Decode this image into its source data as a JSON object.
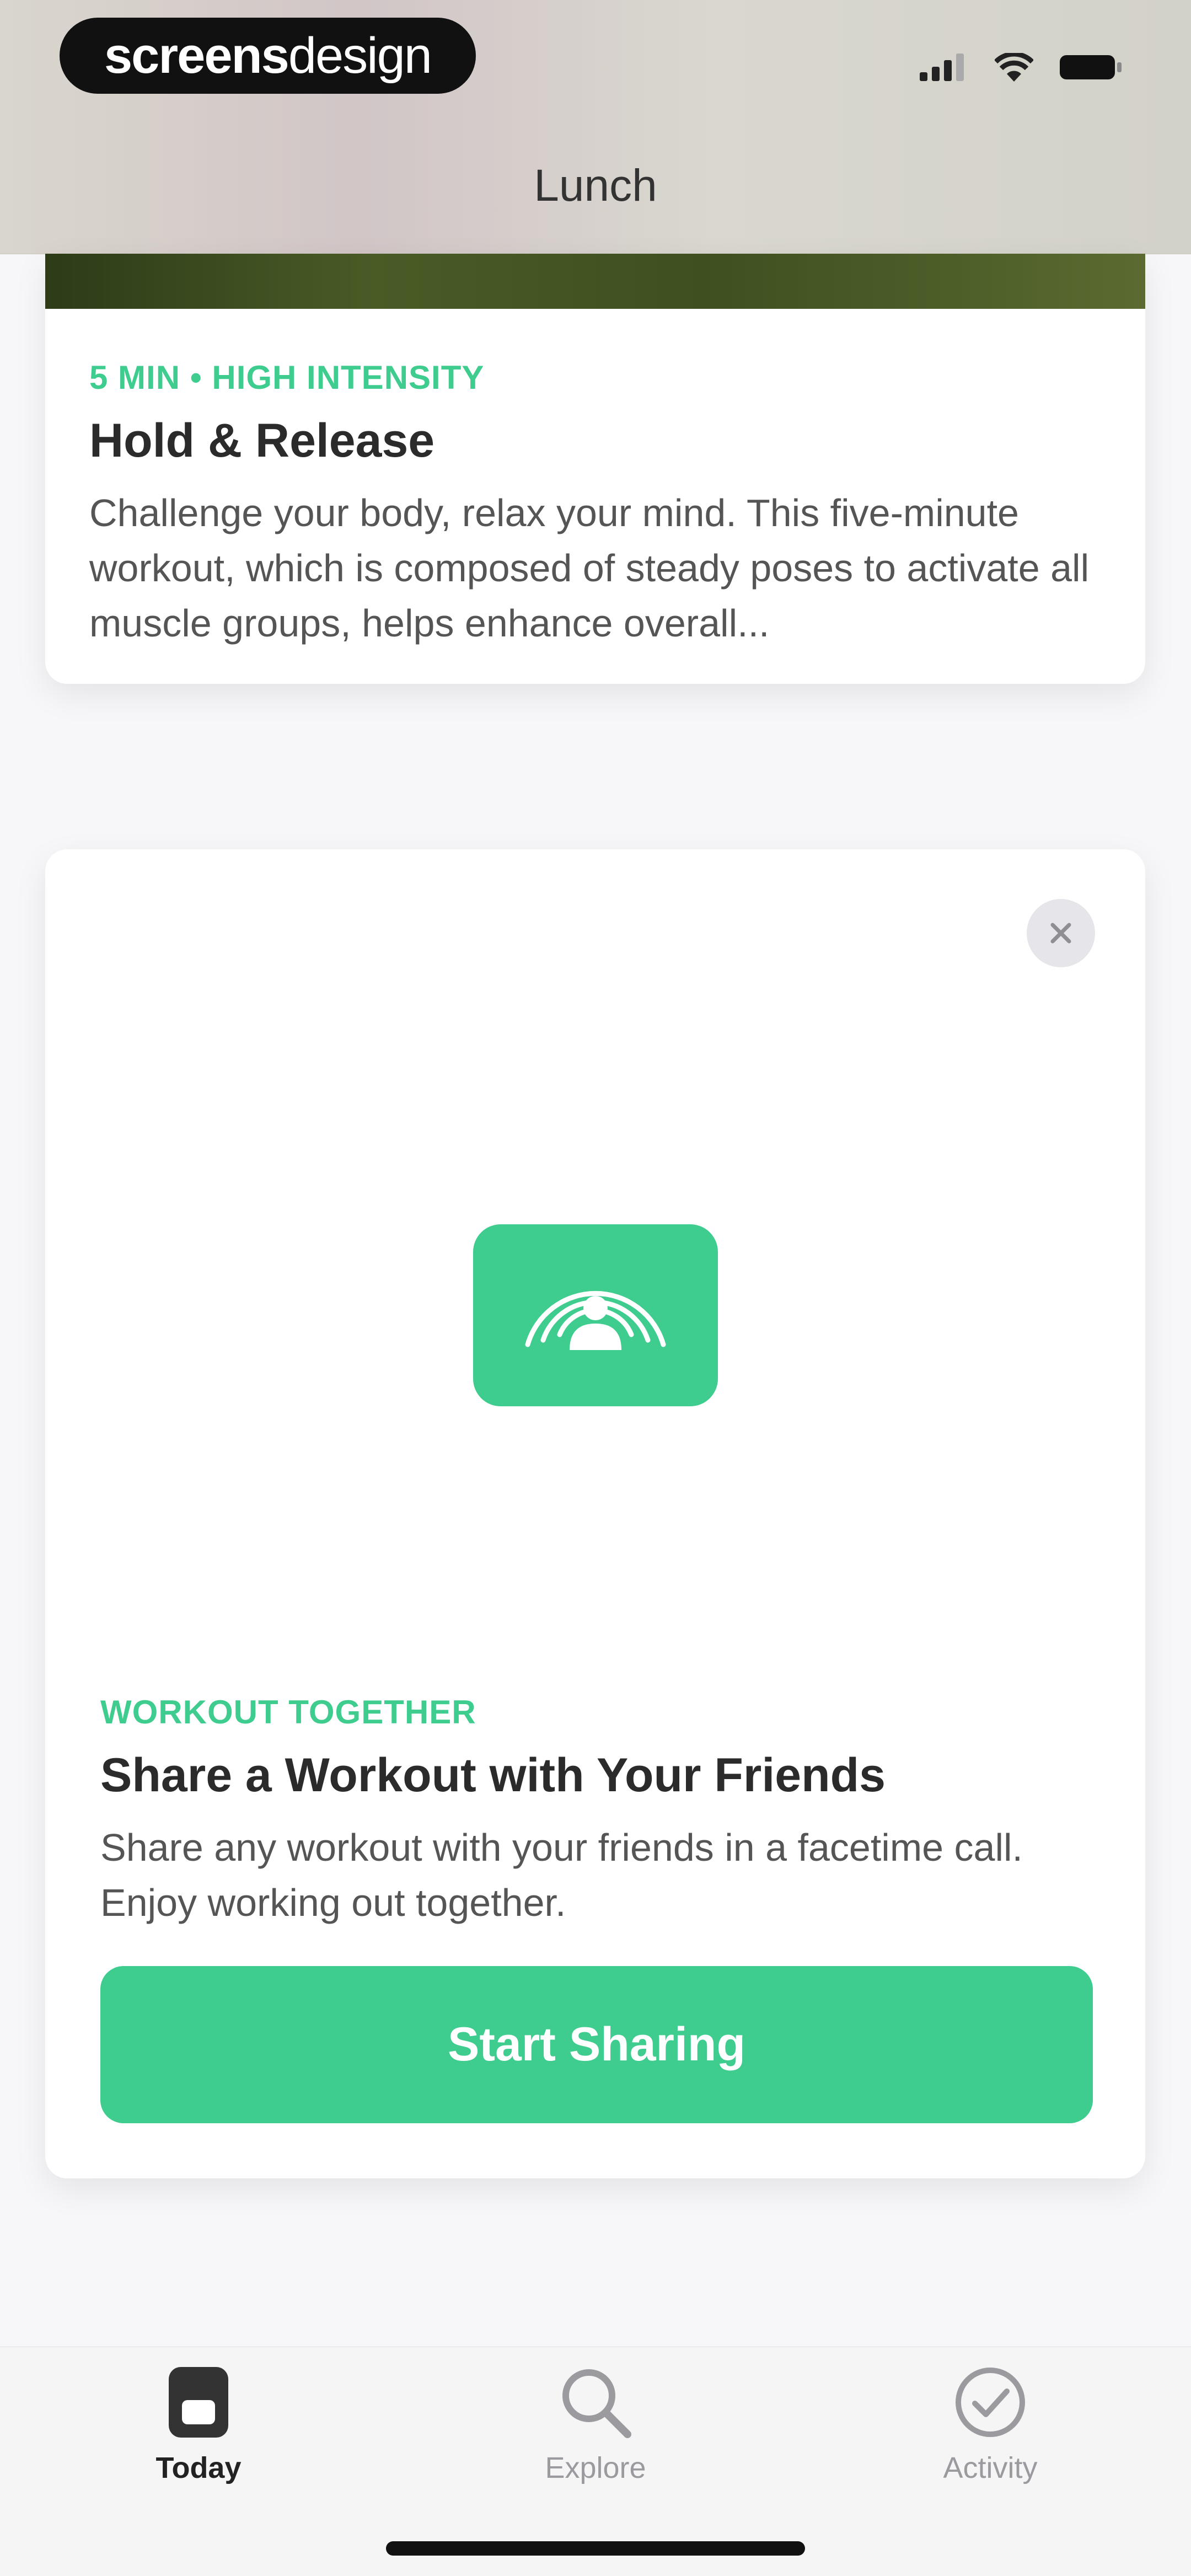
{
  "brand": {
    "bold": "screens",
    "thin": "design"
  },
  "header": {
    "title": "Lunch"
  },
  "workout_card": {
    "kicker": "5 MIN • HIGH INTENSITY",
    "title": "Hold & Release",
    "description": "Challenge your body, relax your mind. This five-minute workout, which is composed of steady poses to activate all muscle groups, helps enhance overall..."
  },
  "share_card": {
    "kicker": "WORKOUT TOGETHER",
    "title": "Share a Workout with Your Friends",
    "description": "Share any workout with your friends in a facetime call. Enjoy working out together.",
    "button_label": "Start Sharing",
    "icon": "shareplay-icon",
    "accent_color": "#3fcc8f"
  },
  "tabbar": {
    "items": [
      {
        "label": "Today",
        "icon": "today-icon",
        "selected": true
      },
      {
        "label": "Explore",
        "icon": "search-icon",
        "selected": false
      },
      {
        "label": "Activity",
        "icon": "checkmark-circle-icon",
        "selected": false
      }
    ]
  }
}
